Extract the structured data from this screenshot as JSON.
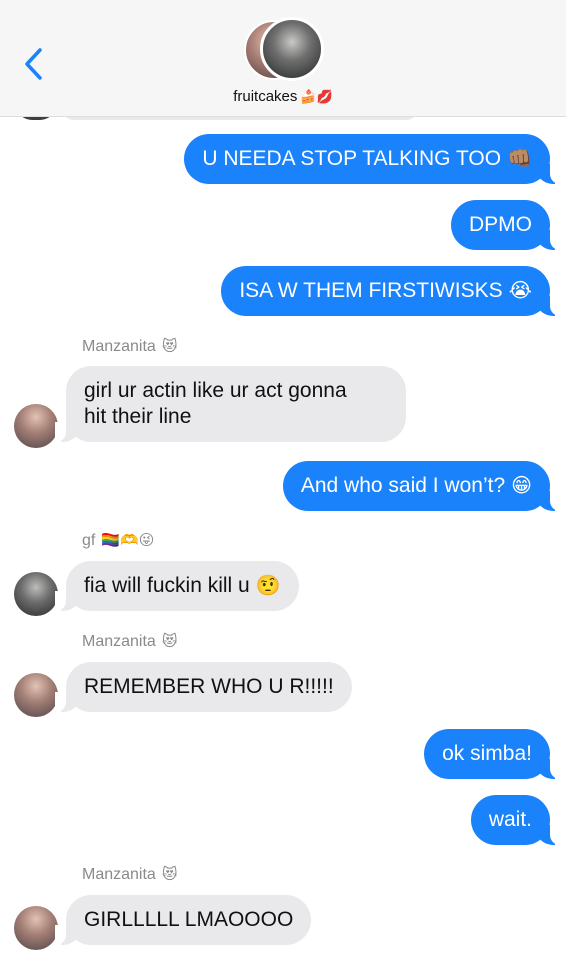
{
  "header": {
    "back_icon": "chevron-left-icon",
    "group_name": "fruitcakes",
    "group_emoji": "🍰💋"
  },
  "messages": [
    {
      "from": "me",
      "text": "U NEEDA STOP TALKING TOO",
      "emoji": "👊🏽"
    },
    {
      "from": "me",
      "text": "DPMO",
      "emoji": ""
    },
    {
      "from": "me",
      "text": "ISA W THEM FIRSTIWISKS",
      "emoji": "😭"
    },
    {
      "from": "Manzanita",
      "sender_label": "Manzanita",
      "sender_emoji": "😻",
      "line1": "girl ur actin like ur act gonna",
      "line2": "hit their line"
    },
    {
      "from": "me",
      "text": "And who said I won’t?",
      "emoji": "😁"
    },
    {
      "from": "gf",
      "sender_label": "gf",
      "sender_emoji": "🏳️‍🌈🫶😜",
      "text": "fia will fuckin kill u",
      "emoji": "🤨"
    },
    {
      "from": "Manzanita",
      "sender_label": "Manzanita",
      "sender_emoji": "😻",
      "text": "REMEMBER WHO U R!!!!!",
      "emoji": ""
    },
    {
      "from": "me",
      "text": "ok simba!",
      "emoji": ""
    },
    {
      "from": "me",
      "text": "wait.",
      "emoji": ""
    },
    {
      "from": "Manzanita",
      "sender_label": "Manzanita",
      "sender_emoji": "😻",
      "text": "GIRLLLLL LMAOOOO",
      "emoji": ""
    }
  ],
  "colors": {
    "outgoing_bubble": "#1a82fb",
    "incoming_bubble": "#e9e9eb",
    "header_bg": "#f6f6f7",
    "accent": "#1a82fb"
  }
}
